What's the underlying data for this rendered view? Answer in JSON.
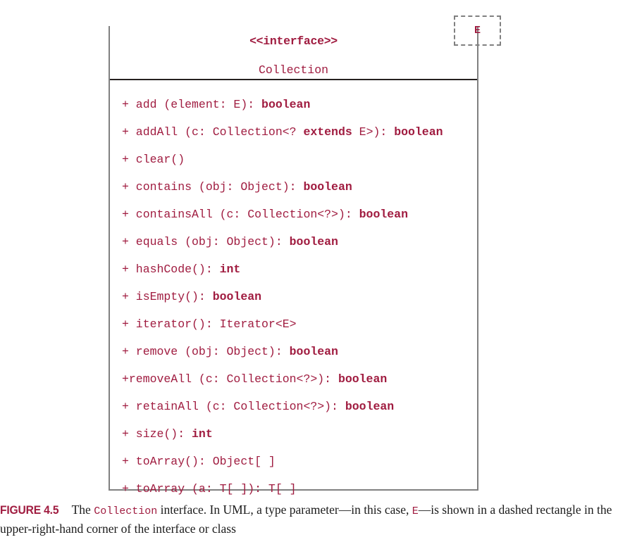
{
  "figure": {
    "type_parameter": "E",
    "class_box": {
      "stereotype": "<<interface>>",
      "name": "Collection",
      "members": [
        {
          "visibility": "+",
          "text_plain": "+ add (element: E): ",
          "text_bold": "boolean"
        },
        {
          "visibility": "+",
          "text_plain": "+ addAll (c: Collection<? ",
          "text_bold": "extends",
          "text_plain2": " E>): ",
          "text_bold2": "boolean"
        },
        {
          "visibility": "+",
          "text_plain": "+ clear()",
          "text_bold": ""
        },
        {
          "visibility": "+",
          "text_plain": "+ contains (obj: Object): ",
          "text_bold": "boolean"
        },
        {
          "visibility": "+",
          "text_plain": "+ containsAll (c: Collection<?>): ",
          "text_bold": "boolean"
        },
        {
          "visibility": "+",
          "text_plain": "+ equals (obj: Object): ",
          "text_bold": "boolean"
        },
        {
          "visibility": "+",
          "text_plain": "+ hashCode(): ",
          "text_bold": "int"
        },
        {
          "visibility": "+",
          "text_plain": "+ isEmpty(): ",
          "text_bold": "boolean"
        },
        {
          "visibility": "+",
          "text_plain": "+ iterator(): Iterator<E>",
          "text_bold": ""
        },
        {
          "visibility": "+",
          "text_plain": "+ remove (obj: Object): ",
          "text_bold": "boolean"
        },
        {
          "visibility": "+",
          "text_plain": "+removeAll (c: Collection<?>): ",
          "text_bold": "boolean"
        },
        {
          "visibility": "+",
          "text_plain": "+ retainAll (c: Collection<?>): ",
          "text_bold": "boolean"
        },
        {
          "visibility": "+",
          "text_plain": "+ size(): ",
          "text_bold": "int"
        },
        {
          "visibility": "+",
          "text_plain": "+ toArray(): Object[ ]",
          "text_bold": ""
        },
        {
          "visibility": "+",
          "text_plain": "+ toArray (a: T[ ]): T[ ]",
          "text_bold": ""
        }
      ]
    }
  },
  "caption": {
    "figure_label": "FIGURE 4.5",
    "part1": "The ",
    "mono1": "Collection",
    "part2": " interface. In UML, a type parameter—in this case, ",
    "mono2": "E",
    "part3": "—is shown in a dashed rectangle in the upper-right-hand corner of the interface or class"
  },
  "colors": {
    "accent_crimson": "#a01c40",
    "box_border_gray": "#808080",
    "divider_dark": "#26201f",
    "caption_text": "#1b1b1b",
    "background": "#ffffff"
  }
}
